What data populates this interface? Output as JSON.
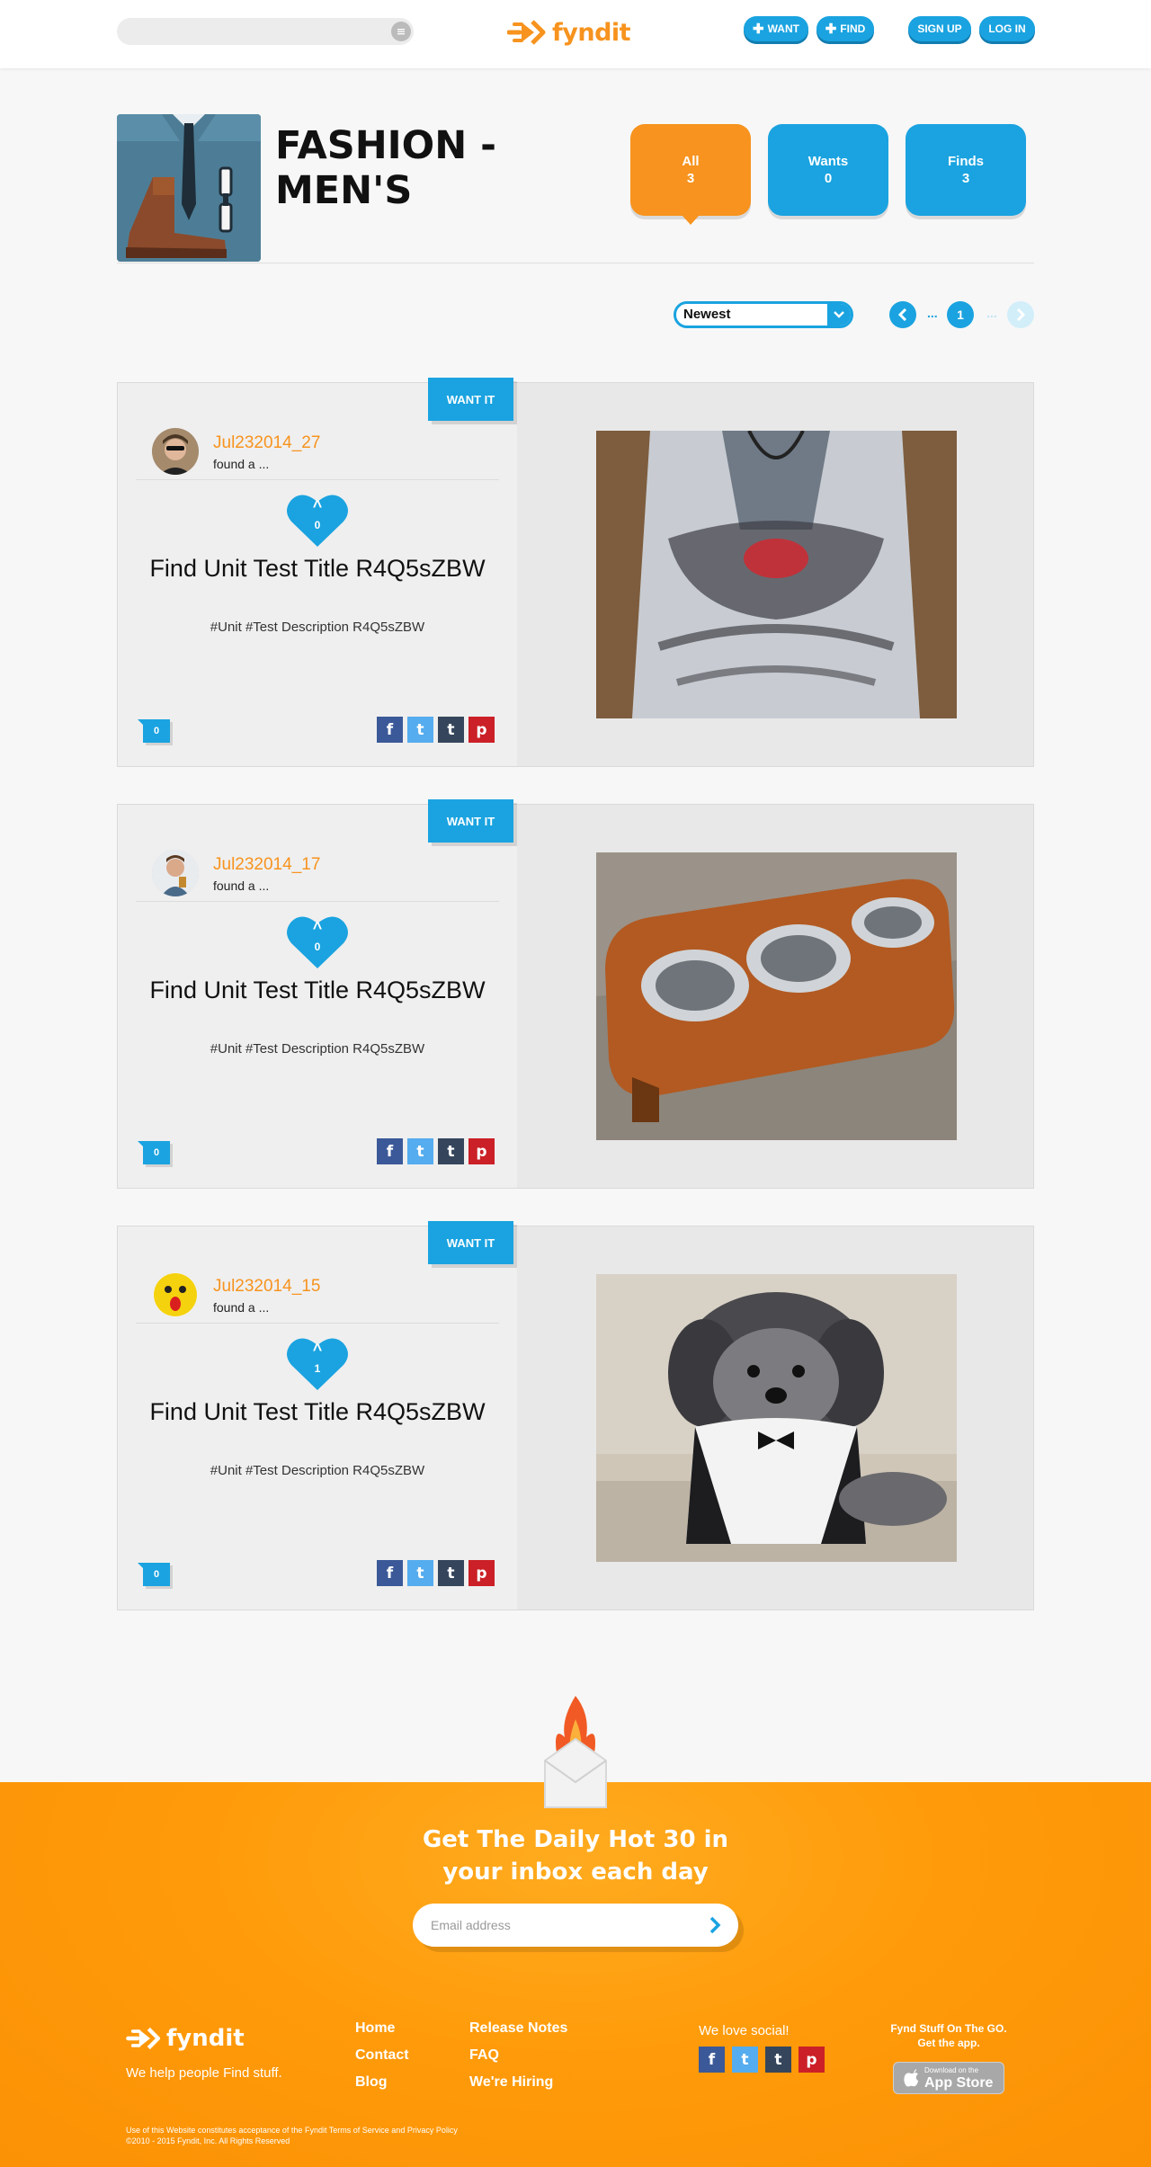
{
  "header": {
    "search_placeholder": "",
    "logo_text": "fyndit",
    "want_label": "WANT",
    "find_label": "FIND",
    "signup_label": "SIGN UP",
    "login_label": "LOG IN"
  },
  "category": {
    "title": "FASHION - MEN'S",
    "tabs": [
      {
        "label": "All",
        "count": "3"
      },
      {
        "label": "Wants",
        "count": "0"
      },
      {
        "label": "Finds",
        "count": "3"
      }
    ]
  },
  "sort": {
    "selected": "Newest"
  },
  "pagination": {
    "prev_dots": "...",
    "current_page": "1",
    "next_dots": "..."
  },
  "finds": [
    {
      "want_label": "WANT IT",
      "username": "Jul232014_27",
      "action": "found a ...",
      "likes": "0",
      "title": "Find Unit Test Title R4Q5sZBW",
      "description": "#Unit #Test Description R4Q5sZBW",
      "comments": "0"
    },
    {
      "want_label": "WANT IT",
      "username": "Jul232014_17",
      "action": "found a ...",
      "likes": "0",
      "title": "Find Unit Test Title R4Q5sZBW",
      "description": "#Unit #Test Description R4Q5sZBW",
      "comments": "0"
    },
    {
      "want_label": "WANT IT",
      "username": "Jul232014_15",
      "action": "found a ...",
      "likes": "1",
      "title": "Find Unit Test Title R4Q5sZBW",
      "description": "#Unit #Test Description R4Q5sZBW",
      "comments": "0"
    }
  ],
  "social_icons": {
    "facebook": "f",
    "twitter": "t",
    "tumblr": "t",
    "pinterest": "p"
  },
  "newsletter": {
    "heading_line1": "Get The Daily Hot 30 in",
    "heading_line2": "your inbox each day",
    "email_placeholder": "Email address"
  },
  "footer": {
    "logo_text": "fyndit",
    "tagline": "We help people Find stuff.",
    "links_col1": [
      "Home",
      "Contact",
      "Blog"
    ],
    "links_col2": [
      "Release Notes",
      "FAQ",
      "We're Hiring"
    ],
    "social_label": "We love social!",
    "app_line1": "Fynd Stuff On The GO.",
    "app_line2": "Get the app.",
    "app_store_small": "Download on the",
    "app_store_big": "App Store",
    "legal_line1": "Use of this Website constitutes acceptance of the Fyndit Terms of Service and Privacy Policy",
    "legal_line2": "©2010 - 2015 Fyndit, Inc. All Rights Reserved"
  },
  "colors": {
    "brand_orange": "#f7931e",
    "brand_blue": "#1aa3e0",
    "facebook": "#3b5998",
    "twitter": "#55acee",
    "tumblr": "#35465c",
    "pinterest": "#cb2027"
  }
}
